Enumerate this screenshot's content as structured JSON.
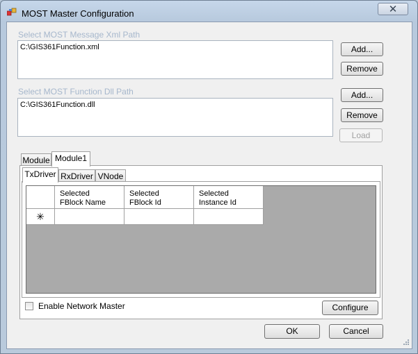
{
  "window": {
    "title": "MOST Master Configuration",
    "close_glyph": "✕"
  },
  "xml_section": {
    "label": "Select MOST Message Xml Path",
    "value": "C:\\GIS361Function.xml",
    "add_label": "Add...",
    "remove_label": "Remove"
  },
  "dll_section": {
    "label": "Select MOST Function Dll Path",
    "value": "C:\\GIS361Function.dll",
    "add_label": "Add...",
    "remove_label": "Remove",
    "load_label": "Load"
  },
  "outer_tabs": [
    {
      "label": "Module"
    },
    {
      "label": "Module1"
    }
  ],
  "inner_tabs": [
    {
      "label": "TxDriver"
    },
    {
      "label": "RxDriver"
    },
    {
      "label": "VNode"
    }
  ],
  "grid": {
    "columns": [
      {
        "line1": "Selected",
        "line2": "FBlock Name"
      },
      {
        "line1": "Selected",
        "line2": "FBlock Id"
      },
      {
        "line1": "Selected",
        "line2": "Instance Id"
      }
    ],
    "new_row_marker": "✳"
  },
  "enable_network_master": {
    "label": "Enable Network Master",
    "checked": false
  },
  "buttons": {
    "configure": "Configure",
    "ok": "OK",
    "cancel": "Cancel"
  },
  "icons": {
    "app": "app-icon",
    "close": "close-icon",
    "resize": "resize-grip-icon"
  }
}
